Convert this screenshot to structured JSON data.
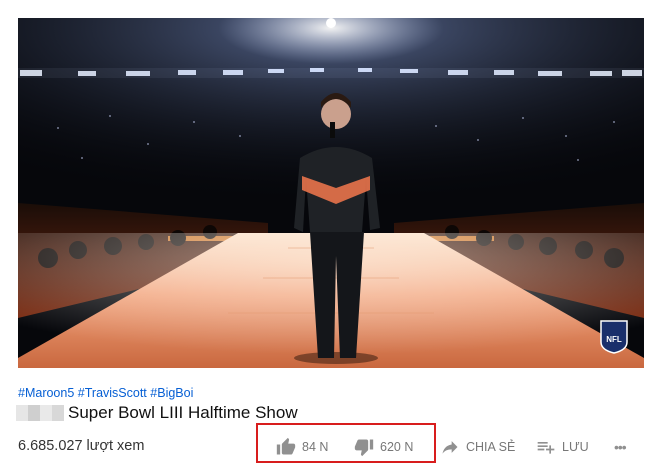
{
  "video": {
    "badge_label": "NFL"
  },
  "hashtags": [
    "#Maroon5",
    "#TravisScott",
    "#BigBoi"
  ],
  "title": "Super Bowl LIII Halftime Show",
  "views": "6.685.027 lượt xem",
  "actions": {
    "like_count": "84 N",
    "dislike_count": "620 N",
    "share_label": "CHIA SẺ",
    "save_label": "LƯU",
    "more_label": "•••"
  },
  "colors": {
    "hashtag": "#065fd4",
    "action_icon": "#909090",
    "highlight": "#d81d1d"
  },
  "icons": [
    "thumbs-up-icon",
    "thumbs-down-icon",
    "share-arrow-icon",
    "playlist-add-icon",
    "more-icon"
  ]
}
